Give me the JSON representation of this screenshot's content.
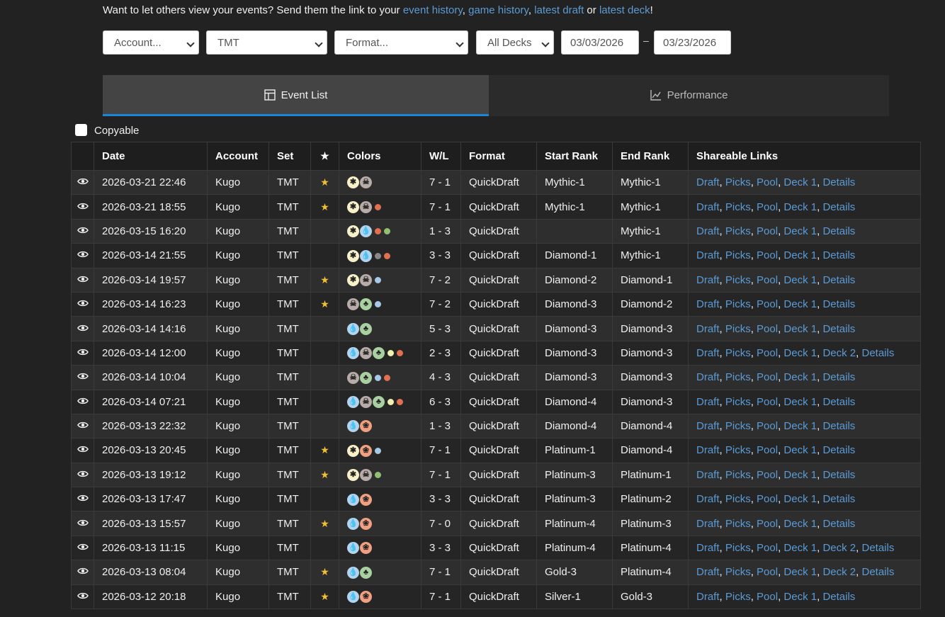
{
  "intro": {
    "prefix": "Want to let others view your events? Send them the link to your ",
    "link_events": "event history",
    "comma1": ", ",
    "link_games": "game history",
    "comma2": ", ",
    "link_draft": "latest draft",
    "or": " or ",
    "link_deck": "latest deck",
    "suffix": "!"
  },
  "filters": {
    "account": "Account...",
    "set": "TMT",
    "format": "Format...",
    "decks": "All Decks",
    "start_date": "03/03/2026",
    "end_date": "03/23/2026",
    "range_sep": "–"
  },
  "tabs": {
    "event_list": "Event List",
    "performance": "Performance"
  },
  "copyable_label": "Copyable",
  "table": {
    "headers": [
      "Date",
      "Account",
      "Set",
      "Colors",
      "W/L",
      "Format",
      "Start Rank",
      "End Rank",
      "Shareable Links"
    ],
    "rows": [
      {
        "date": "2026-03-21 22:46",
        "account": "Kugo",
        "set": "TMT",
        "star": true,
        "colors": [
          "W",
          "B"
        ],
        "dots": [],
        "wl": "7 - 1",
        "format": "QuickDraft",
        "start": "Mythic-1",
        "end": "Mythic-1",
        "deck2": false
      },
      {
        "date": "2026-03-21 18:55",
        "account": "Kugo",
        "set": "TMT",
        "star": true,
        "colors": [
          "W",
          "B"
        ],
        "dots": [
          "#e07050"
        ],
        "wl": "7 - 1",
        "format": "QuickDraft",
        "start": "Mythic-1",
        "end": "Mythic-1",
        "deck2": false
      },
      {
        "date": "2026-03-15 16:20",
        "account": "Kugo",
        "set": "TMT",
        "star": false,
        "colors": [
          "W",
          "U"
        ],
        "dots": [
          "#e07050",
          "#90c070"
        ],
        "wl": "1 - 3",
        "format": "QuickDraft",
        "start": "",
        "end": "Mythic-1",
        "deck2": false
      },
      {
        "date": "2026-03-14 21:55",
        "account": "Kugo",
        "set": "TMT",
        "star": false,
        "colors": [
          "W",
          "U"
        ],
        "dots": [
          "#888888",
          "#e07050"
        ],
        "wl": "3 - 3",
        "format": "QuickDraft",
        "start": "Diamond-1",
        "end": "Mythic-1",
        "deck2": false
      },
      {
        "date": "2026-03-14 19:57",
        "account": "Kugo",
        "set": "TMT",
        "star": true,
        "colors": [
          "W",
          "B"
        ],
        "dots": [
          "#a8c8e8"
        ],
        "wl": "7 - 2",
        "format": "QuickDraft",
        "start": "Diamond-2",
        "end": "Diamond-1",
        "deck2": false
      },
      {
        "date": "2026-03-14 16:23",
        "account": "Kugo",
        "set": "TMT",
        "star": true,
        "colors": [
          "B",
          "G"
        ],
        "dots": [
          "#a8c8e8"
        ],
        "wl": "7 - 2",
        "format": "QuickDraft",
        "start": "Diamond-3",
        "end": "Diamond-2",
        "deck2": false
      },
      {
        "date": "2026-03-14 14:16",
        "account": "Kugo",
        "set": "TMT",
        "star": false,
        "colors": [
          "U",
          "G"
        ],
        "dots": [],
        "wl": "5 - 3",
        "format": "QuickDraft",
        "start": "Diamond-3",
        "end": "Diamond-3",
        "deck2": false
      },
      {
        "date": "2026-03-14 12:00",
        "account": "Kugo",
        "set": "TMT",
        "star": false,
        "colors": [
          "U",
          "B",
          "G"
        ],
        "dots": [
          "#f0f0b0",
          "#e07050"
        ],
        "wl": "2 - 3",
        "format": "QuickDraft",
        "start": "Diamond-3",
        "end": "Diamond-3",
        "deck2": true
      },
      {
        "date": "2026-03-14 10:04",
        "account": "Kugo",
        "set": "TMT",
        "star": false,
        "colors": [
          "B",
          "G"
        ],
        "dots": [
          "#a8c8e8",
          "#e07050"
        ],
        "wl": "4 - 3",
        "format": "QuickDraft",
        "start": "Diamond-3",
        "end": "Diamond-3",
        "deck2": false
      },
      {
        "date": "2026-03-14 07:21",
        "account": "Kugo",
        "set": "TMT",
        "star": false,
        "colors": [
          "U",
          "B",
          "G"
        ],
        "dots": [
          "#f0f0b0",
          "#e07050"
        ],
        "wl": "6 - 3",
        "format": "QuickDraft",
        "start": "Diamond-4",
        "end": "Diamond-3",
        "deck2": false
      },
      {
        "date": "2026-03-13 22:32",
        "account": "Kugo",
        "set": "TMT",
        "star": false,
        "colors": [
          "U",
          "R"
        ],
        "dots": [],
        "wl": "1 - 3",
        "format": "QuickDraft",
        "start": "Diamond-4",
        "end": "Diamond-4",
        "deck2": false
      },
      {
        "date": "2026-03-13 20:45",
        "account": "Kugo",
        "set": "TMT",
        "star": true,
        "colors": [
          "W",
          "R"
        ],
        "dots": [
          "#a8c8e8"
        ],
        "wl": "7 - 1",
        "format": "QuickDraft",
        "start": "Platinum-1",
        "end": "Diamond-4",
        "deck2": false
      },
      {
        "date": "2026-03-13 19:12",
        "account": "Kugo",
        "set": "TMT",
        "star": true,
        "colors": [
          "W",
          "B"
        ],
        "dots": [
          "#90c070"
        ],
        "wl": "7 - 1",
        "format": "QuickDraft",
        "start": "Platinum-3",
        "end": "Platinum-1",
        "deck2": false
      },
      {
        "date": "2026-03-13 17:47",
        "account": "Kugo",
        "set": "TMT",
        "star": false,
        "colors": [
          "U",
          "R"
        ],
        "dots": [],
        "wl": "3 - 3",
        "format": "QuickDraft",
        "start": "Platinum-3",
        "end": "Platinum-2",
        "deck2": false
      },
      {
        "date": "2026-03-13 15:57",
        "account": "Kugo",
        "set": "TMT",
        "star": true,
        "colors": [
          "U",
          "R"
        ],
        "dots": [],
        "wl": "7 - 0",
        "format": "QuickDraft",
        "start": "Platinum-4",
        "end": "Platinum-3",
        "deck2": false
      },
      {
        "date": "2026-03-13 11:15",
        "account": "Kugo",
        "set": "TMT",
        "star": false,
        "colors": [
          "U",
          "R"
        ],
        "dots": [],
        "wl": "3 - 3",
        "format": "QuickDraft",
        "start": "Platinum-4",
        "end": "Platinum-4",
        "deck2": true
      },
      {
        "date": "2026-03-13 08:04",
        "account": "Kugo",
        "set": "TMT",
        "star": true,
        "colors": [
          "U",
          "G"
        ],
        "dots": [],
        "wl": "7 - 1",
        "format": "QuickDraft",
        "start": "Gold-3",
        "end": "Platinum-4",
        "deck2": true
      },
      {
        "date": "2026-03-12 20:18",
        "account": "Kugo",
        "set": "TMT",
        "star": true,
        "colors": [
          "U",
          "R"
        ],
        "dots": [],
        "wl": "7 - 1",
        "format": "QuickDraft",
        "start": "Silver-1",
        "end": "Gold-3",
        "deck2": false
      }
    ]
  },
  "links": {
    "draft": "Draft",
    "picks": "Picks",
    "pool": "Pool",
    "deck1": "Deck 1",
    "deck2": "Deck 2",
    "details": "Details"
  },
  "mana_glyphs": {
    "W": "✱",
    "U": "💧",
    "B": "☠",
    "R": "❀",
    "G": "♣"
  },
  "icons": {
    "view": "eye-icon",
    "star": "star-icon",
    "table": "table-icon",
    "chart": "line-chart-icon",
    "select": "chevron-down-icon"
  }
}
